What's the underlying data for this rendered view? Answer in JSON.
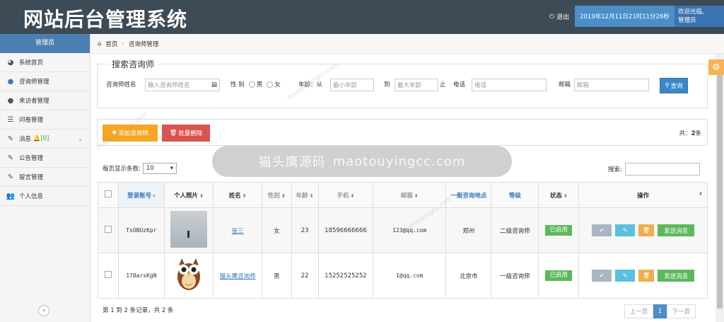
{
  "header": {
    "title": "网站后台管理系统",
    "logout": "退出",
    "datetime": "2019年12月11日21时11分26秒",
    "welcome_line1": "欢迎光临,",
    "welcome_line2": "管理员"
  },
  "sidebar": {
    "title": "管理员",
    "items": [
      {
        "label": "系统首页",
        "icon": "dashboard-icon"
      },
      {
        "label": "咨询师管理",
        "icon": "user-icon"
      },
      {
        "label": "来访者管理",
        "icon": "user-icon"
      },
      {
        "label": "问卷管理",
        "icon": "list-icon"
      },
      {
        "label": "消息",
        "badge": "[0]",
        "icon": "edit-icon"
      },
      {
        "label": "公告管理",
        "icon": "edit-icon"
      },
      {
        "label": "留言管理",
        "icon": "edit-icon"
      },
      {
        "label": "个人信息",
        "icon": "users-icon"
      }
    ]
  },
  "breadcrumb": {
    "home": "首页",
    "current": "咨询师管理"
  },
  "search": {
    "title": "搜索咨询师",
    "name_label": "咨询师姓名",
    "name_placeholder": "输入咨询师姓名",
    "gender_label": "性 别",
    "gender_male": "男",
    "gender_female": "女",
    "age_label": "年龄：从",
    "age_min_placeholder": "最小年龄",
    "age_to": "到",
    "age_max_placeholder": "最大年龄",
    "age_end": "止",
    "phone_label": "电话",
    "phone_placeholder": "电话",
    "email_label": "邮箱",
    "email_placeholder": "邮箱",
    "query_button": "查询"
  },
  "toolbar": {
    "add_button": "添加咨询师",
    "delete_button": "批量删除",
    "total_prefix": "共：",
    "total_count": "2",
    "total_suffix": "条"
  },
  "page_size": {
    "label": "每页显示条数:",
    "value": "10"
  },
  "table_search_label": "搜索:",
  "table": {
    "columns": [
      "登录账号",
      "个人照片",
      "姓名",
      "性别",
      "年龄",
      "手机",
      "邮箱",
      "一般咨询地点",
      "等级",
      "状态",
      "操作"
    ],
    "rows": [
      {
        "account": "TsOBUzKpr",
        "name": "张三",
        "gender": "女",
        "age": "23",
        "phone": "18596666666",
        "email": "123@qq.com",
        "location": "郑州",
        "level": "二级咨询师",
        "status": "已启用",
        "send": "发送消息"
      },
      {
        "account": "178arsKgN",
        "name": "猫头鹰咨询师",
        "gender": "男",
        "age": "22",
        "phone": "15252525252",
        "email": "1@qq.com",
        "location": "北京市",
        "level": "一级咨询师",
        "status": "已启用",
        "send": "发送消息"
      }
    ]
  },
  "footer": {
    "records": "第 1 到 2 条记录，共 2 条",
    "prev": "上一页",
    "current_page": "1",
    "next": "下一页"
  },
  "watermark": {
    "main": "猫头鹰源码",
    "url": "maotouyingcc.com",
    "diag": "maotouyingcc.com"
  },
  "colors": {
    "header_bg": "#3d4b57",
    "accent_blue": "#4b8fc9",
    "add_orange": "#f5a623",
    "delete_red": "#d9534f",
    "status_green": "#5cb85c"
  }
}
